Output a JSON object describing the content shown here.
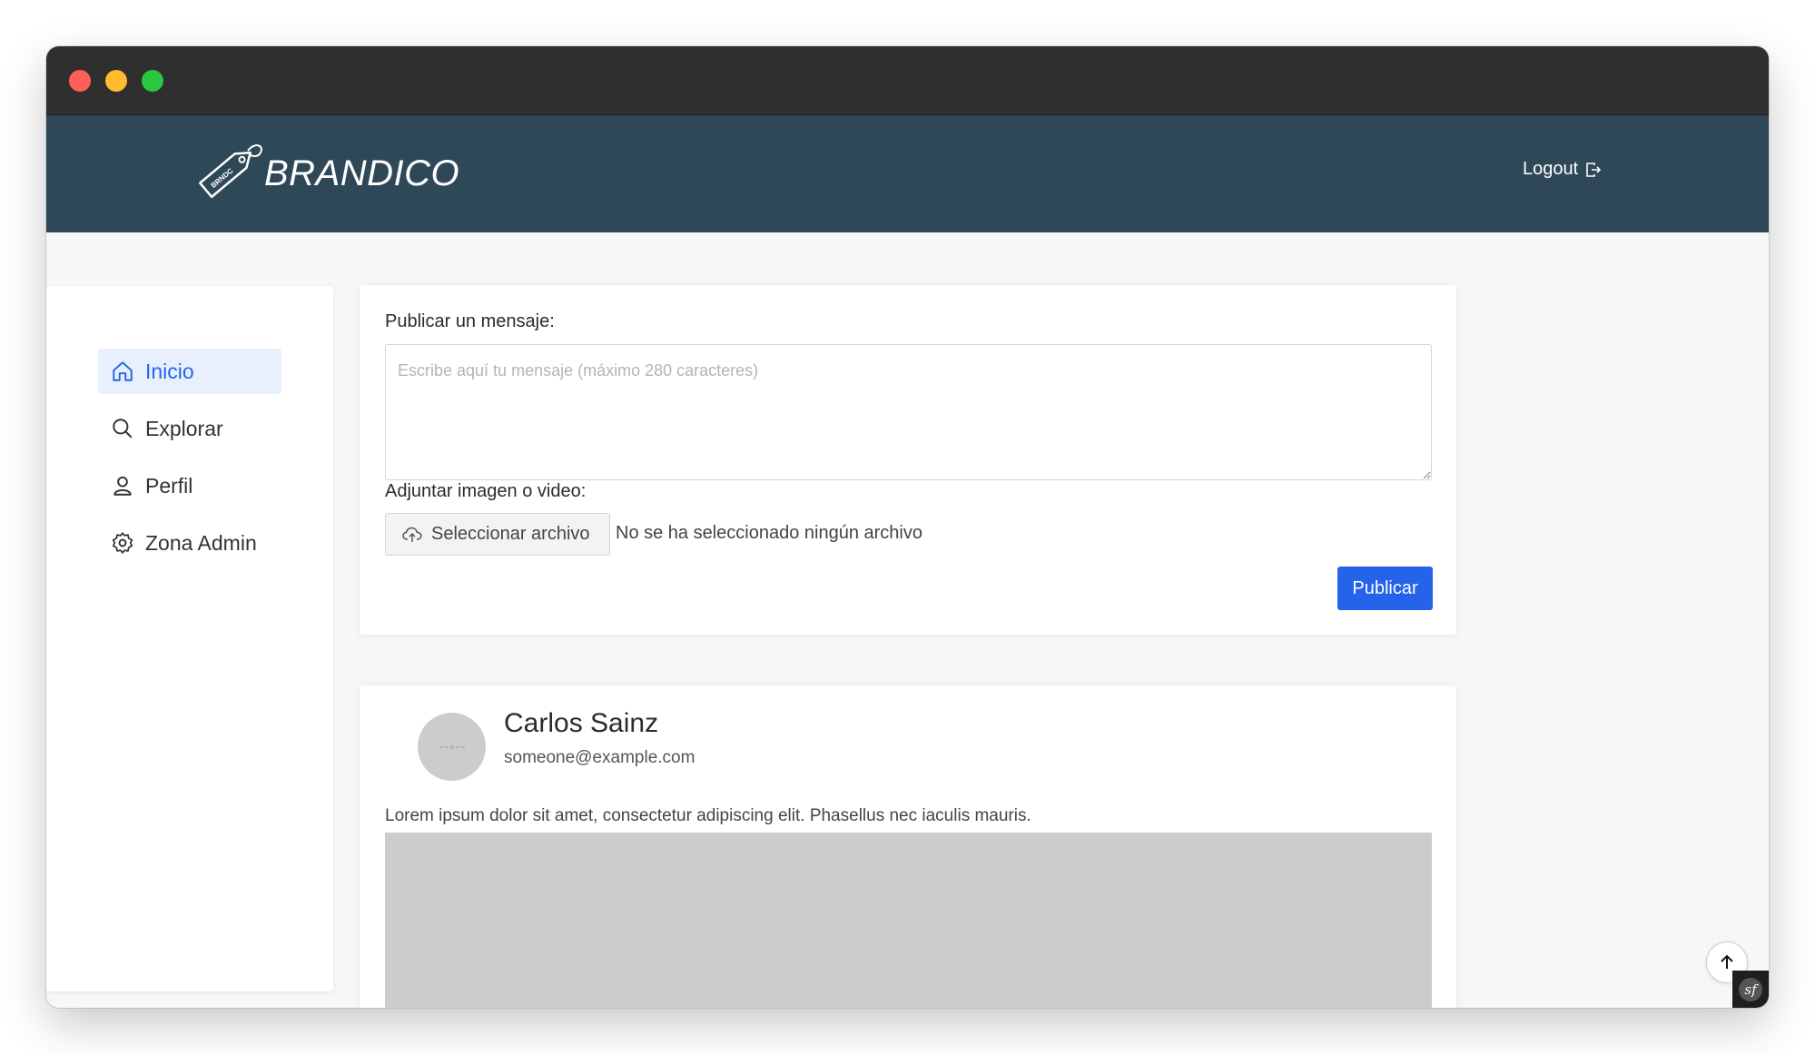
{
  "header": {
    "brand": "BRANDICO",
    "logo_tag_text": "BRNDC",
    "logout_label": "Logout"
  },
  "sidebar": {
    "items": [
      {
        "label": "Inicio",
        "icon": "home-icon",
        "active": true
      },
      {
        "label": "Explorar",
        "icon": "search-icon",
        "active": false
      },
      {
        "label": "Perfil",
        "icon": "user-icon",
        "active": false
      },
      {
        "label": "Zona Admin",
        "icon": "gear-icon",
        "active": false
      }
    ]
  },
  "composer": {
    "message_label": "Publicar un mensaje:",
    "message_placeholder": "Escribe aquí tu mensaje (máximo 280 caracteres)",
    "attach_label": "Adjuntar imagen o video:",
    "file_button_label": "Seleccionar archivo",
    "file_status": "No se ha seleccionado ningún archivo",
    "publish_label": "Publicar"
  },
  "post": {
    "author": "Carlos Sainz",
    "email": "someone@example.com",
    "text": "Lorem ipsum dolor sit amet, consectetur adipiscing elit. Phasellus nec iaculis mauris."
  },
  "colors": {
    "header_bg": "#2f4858",
    "accent": "#2563eb",
    "active_nav_bg": "#e8f0fe",
    "placeholder_gray": "#cccccc"
  }
}
